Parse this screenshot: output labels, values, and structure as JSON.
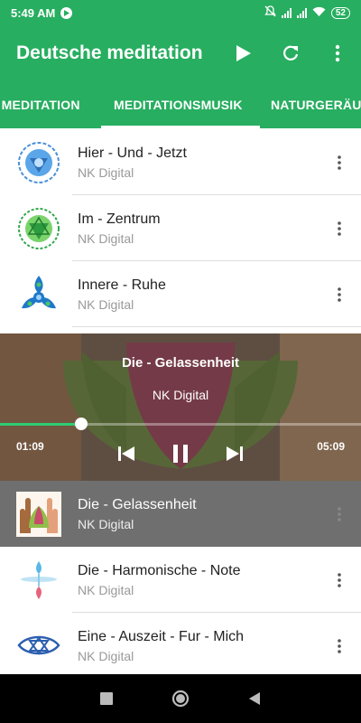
{
  "status": {
    "time": "5:49 AM",
    "battery": "52"
  },
  "app": {
    "title": "Deutsche meditation"
  },
  "tabs": [
    {
      "label": "E MEDITATION"
    },
    {
      "label": "MEDITATIONSMUSIK"
    },
    {
      "label": "NATURGERÄU"
    }
  ],
  "tracks_top": [
    {
      "title": "Hier - Und - Jetzt",
      "artist": "NK Digital"
    },
    {
      "title": "Im - Zentrum",
      "artist": "NK Digital"
    },
    {
      "title": "Innere - Ruhe",
      "artist": "NK Digital"
    }
  ],
  "player": {
    "title": "Die - Gelassenheit",
    "artist": "NK Digital",
    "elapsed": "01:09",
    "duration": "05:09",
    "progress": 0.225
  },
  "tracks_bottom": [
    {
      "title": "Die - Gelassenheit",
      "artist": "NK Digital"
    },
    {
      "title": "Die - Harmonische - Note",
      "artist": "NK Digital"
    },
    {
      "title": "Eine - Auszeit - Fur - Mich",
      "artist": "NK Digital"
    }
  ],
  "colors": {
    "primary": "#27ae60",
    "active_row": "#6f6f6f"
  }
}
